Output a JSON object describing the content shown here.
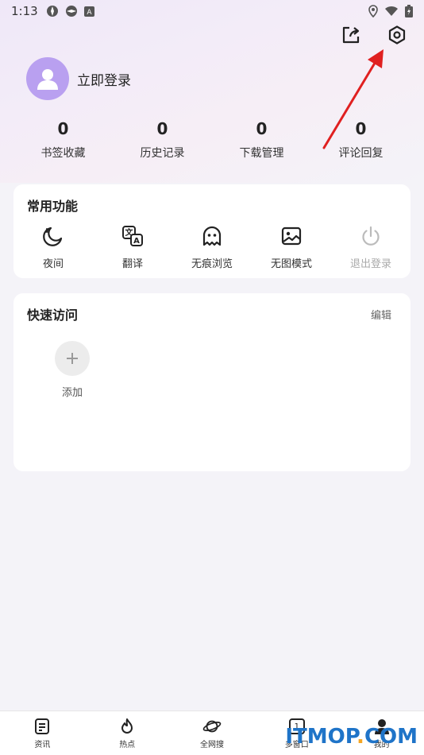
{
  "status_bar": {
    "time": "1:13"
  },
  "header": {
    "login_label": "立即登录"
  },
  "stats": [
    {
      "count": "0",
      "label": "书签收藏"
    },
    {
      "count": "0",
      "label": "历史记录"
    },
    {
      "count": "0",
      "label": "下载管理"
    },
    {
      "count": "0",
      "label": "评论回复"
    }
  ],
  "common_functions": {
    "title": "常用功能",
    "items": [
      {
        "label": "夜间",
        "icon": "moon-icon"
      },
      {
        "label": "翻译",
        "icon": "translate-icon"
      },
      {
        "label": "无痕浏览",
        "icon": "ghost-icon"
      },
      {
        "label": "无图模式",
        "icon": "image-icon"
      },
      {
        "label": "退出登录",
        "icon": "power-icon"
      }
    ]
  },
  "quick_access": {
    "title": "快速访问",
    "edit_label": "编辑",
    "add_label": "添加"
  },
  "bottom_nav": [
    {
      "label": "资讯",
      "icon": "news-icon"
    },
    {
      "label": "热点",
      "icon": "flame-icon"
    },
    {
      "label": "全网搜",
      "icon": "planet-icon"
    },
    {
      "label": "多窗口",
      "icon": "windows-icon",
      "badge": "1"
    },
    {
      "label": "我的",
      "icon": "user-icon"
    }
  ],
  "watermark": {
    "text": "ITMOP",
    "suffix": "COM"
  },
  "colors": {
    "accent": "#b9a0f0",
    "annotation_arrow": "#e02020",
    "watermark": "#1f74c8"
  }
}
